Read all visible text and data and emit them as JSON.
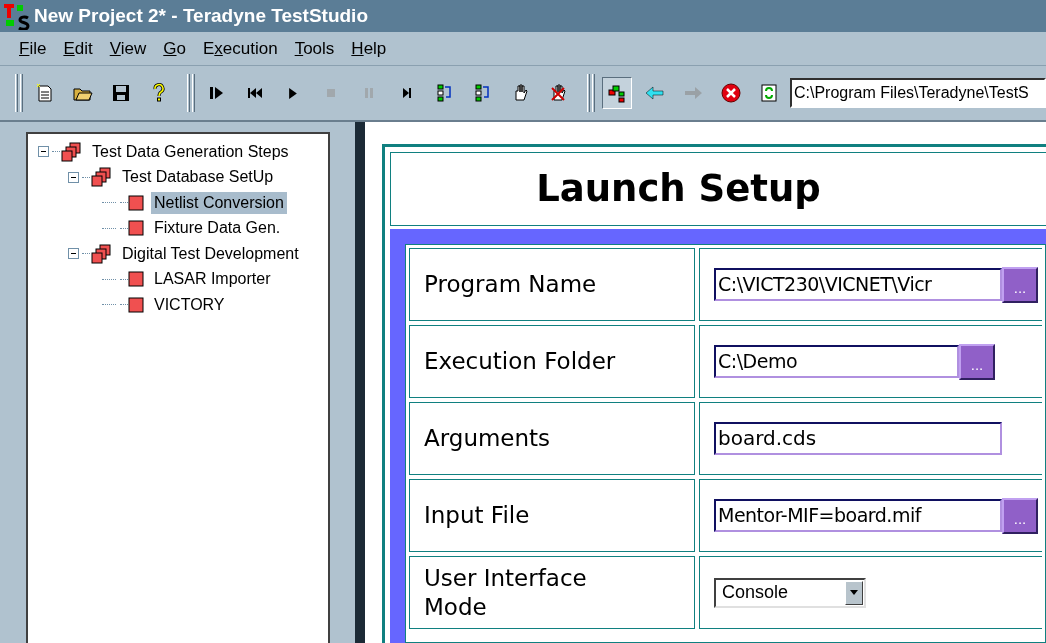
{
  "window": {
    "title": "New Project 2* - Teradyne TestStudio"
  },
  "menu": [
    {
      "key": "F",
      "after": "ile"
    },
    {
      "key": "E",
      "after": "dit"
    },
    {
      "key": "V",
      "after": "iew"
    },
    {
      "key": "G",
      "after": "o"
    },
    {
      "before": "E",
      "key": "x",
      "after": "ecution"
    },
    {
      "key": "T",
      "after": "ools"
    },
    {
      "key": "H",
      "after": "elp"
    }
  ],
  "toolbar": {
    "groups": [
      [
        {
          "kind": "new",
          "disabled": false
        },
        {
          "kind": "open",
          "disabled": false
        },
        {
          "kind": "save",
          "disabled": false
        },
        {
          "kind": "help",
          "disabled": false
        }
      ],
      [
        {
          "kind": "step-into",
          "disabled": false
        },
        {
          "kind": "rewind",
          "disabled": false
        },
        {
          "kind": "run",
          "disabled": false
        },
        {
          "kind": "stop",
          "disabled": true
        },
        {
          "kind": "pause",
          "disabled": true
        },
        {
          "kind": "step-end",
          "disabled": false
        },
        {
          "kind": "loop-down",
          "disabled": false
        },
        {
          "kind": "loop-back",
          "disabled": false
        },
        {
          "kind": "hand",
          "disabled": false
        },
        {
          "kind": "hand-off",
          "disabled": false
        }
      ],
      [
        {
          "kind": "tree",
          "disabled": false,
          "selected": true
        },
        {
          "kind": "back",
          "disabled": false,
          "selected": false
        },
        {
          "kind": "forward",
          "disabled": true,
          "selected": false
        },
        {
          "kind": "cancel",
          "disabled": false,
          "selected": false
        },
        {
          "kind": "refresh",
          "disabled": false,
          "selected": false
        }
      ]
    ],
    "path": "C:\\Program Files\\Teradyne\\TestS"
  },
  "tree": [
    {
      "label": "Test Data Generation Steps",
      "kind": "group",
      "selected": false,
      "expanded": true,
      "children": [
        {
          "label": "Test Database SetUp",
          "kind": "group",
          "selected": false,
          "expanded": true,
          "children": [
            {
              "label": "Netlist Conversion",
              "kind": "step",
              "selected": true
            },
            {
              "label": "Fixture Data Gen.",
              "kind": "step",
              "selected": false
            }
          ]
        },
        {
          "label": "Digital Test Development",
          "kind": "group",
          "selected": false,
          "expanded": true,
          "children": [
            {
              "label": "LASAR Importer",
              "kind": "step",
              "selected": false
            },
            {
              "label": "VICTORY",
              "kind": "step",
              "selected": false
            }
          ]
        }
      ]
    }
  ],
  "form": {
    "title": "Launch Setup",
    "rows": [
      {
        "label": "Program Name",
        "kind": "browse",
        "value": "C:\\VICT230\\VICNET\\Vicr",
        "button": "..."
      },
      {
        "label": "Execution Folder",
        "kind": "browse",
        "value": "C:\\Demo",
        "button": "..."
      },
      {
        "label": "Arguments",
        "kind": "text",
        "value": "board.cds"
      },
      {
        "label": "Input File",
        "kind": "browse",
        "value": "Mentor-MIF=board.mif",
        "button": "..."
      },
      {
        "label": "User Interface Mode",
        "kind": "select",
        "value": "Console"
      }
    ]
  }
}
